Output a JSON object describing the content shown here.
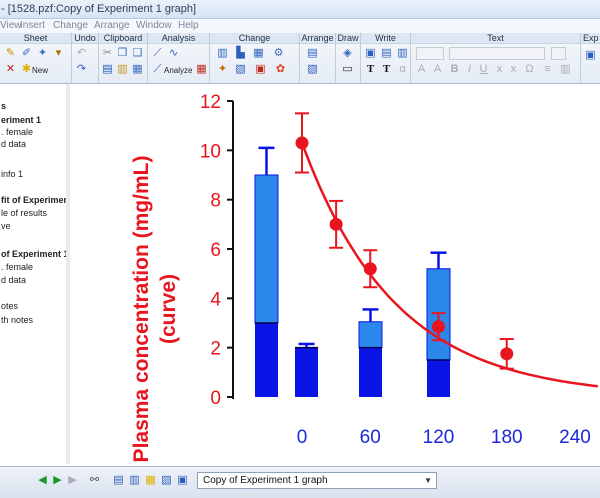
{
  "window": {
    "title": "- [1528.pzf:Copy of Experiment 1 graph]"
  },
  "menu": [
    "View",
    "Insert",
    "Change",
    "Arrange",
    "Window",
    "Help"
  ],
  "ribbon": {
    "groups": [
      "Sheet",
      "Undo",
      "Clipboard",
      "Analysis",
      "Change",
      "Arrange",
      "Draw",
      "Write",
      "Text",
      "Exp"
    ],
    "new_label": "New",
    "analyze_label": "Analyze"
  },
  "navigator": {
    "items": [
      {
        "text": "s",
        "bold": true
      },
      {
        "text": "eriment 1",
        "bold": true
      },
      {
        "text": ". female",
        "bold": false
      },
      {
        "text": "d data",
        "bold": false
      },
      {
        "text": "info 1",
        "bold": false
      },
      {
        "text": "fit of Experimer",
        "bold": true
      },
      {
        "text": "le of results",
        "bold": false
      },
      {
        "text": "ve",
        "bold": false
      },
      {
        "text": "of Experiment 1 g",
        "bold": true
      },
      {
        "text": ". female",
        "bold": false
      },
      {
        "text": "d data",
        "bold": false
      },
      {
        "text": "otes",
        "bold": false
      },
      {
        "text": "th notes",
        "bold": false
      }
    ]
  },
  "chart_data": {
    "type": "bar+scatter",
    "ylabel_line1": "Plasma concentration (mg/mL)",
    "ylabel_line2": "(curve)",
    "ylim": [
      0,
      12
    ],
    "yticks": [
      "0",
      "2",
      "4",
      "6",
      "8",
      "10",
      "12"
    ],
    "xticks": [
      "0",
      "60",
      "120",
      "180",
      "240"
    ],
    "bars": [
      {
        "group": 1,
        "dark": 3.0,
        "total": 9.0,
        "err_upper": 10.1
      },
      {
        "group": 2,
        "dark": 2.0,
        "total": 2.0,
        "err_upper": 2.15
      },
      {
        "group": 3,
        "dark": 2.0,
        "total": 3.05,
        "err_upper": 3.55
      },
      {
        "group": 4,
        "dark": 1.5,
        "total": 5.2,
        "err_upper": 5.85
      }
    ],
    "points": [
      {
        "x": 0,
        "y": 10.3,
        "err": 1.2
      },
      {
        "x": 30,
        "y": 7.0,
        "err": 0.95
      },
      {
        "x": 60,
        "y": 5.2,
        "err": 0.75
      },
      {
        "x": 120,
        "y": 2.85,
        "err": 0.55
      },
      {
        "x": 180,
        "y": 1.75,
        "err": 0.6
      }
    ],
    "curve": {
      "y0": 10.3,
      "half_life_min": 57
    },
    "colors": {
      "curve": "#e8151e",
      "bar_dark": "#0a14e6",
      "bar_light": "#2b88ea",
      "axis_text_y": "#e8151e",
      "axis_text_x": "#1c2ad6"
    }
  },
  "bottom": {
    "sheet_name": "Copy of Experiment 1 graph"
  }
}
